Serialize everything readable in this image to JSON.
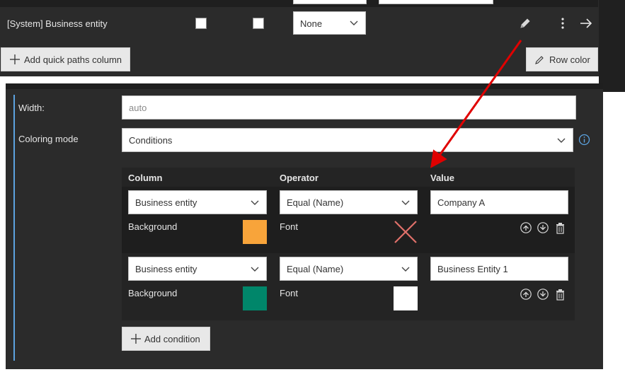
{
  "row": {
    "label": "[System] Business entity",
    "select_value": "None"
  },
  "buttons": {
    "add_quick_paths": "Add quick paths column",
    "row_color": "Row color",
    "add_condition": "Add condition"
  },
  "panel": {
    "width_label": "Width:",
    "width_placeholder": "auto",
    "coloring_label": "Coloring mode",
    "coloring_value": "Conditions"
  },
  "conditions": {
    "headers": {
      "column": "Column",
      "operator": "Operator",
      "value": "Value"
    },
    "rows": [
      {
        "column": "Business entity",
        "operator": "Equal (Name)",
        "value": "Company A",
        "background_label": "Background",
        "font_label": "Font",
        "background_color": "#f8a43a",
        "font_color": "none"
      },
      {
        "column": "Business entity",
        "operator": "Equal (Name)",
        "value": "Business Entity 1",
        "background_label": "Background",
        "font_label": "Font",
        "background_color": "#00866a",
        "font_color": "#ffffff"
      }
    ]
  },
  "colors": {
    "accent_line": "#5ca3e0",
    "annotation_arrow": "#e00000"
  }
}
